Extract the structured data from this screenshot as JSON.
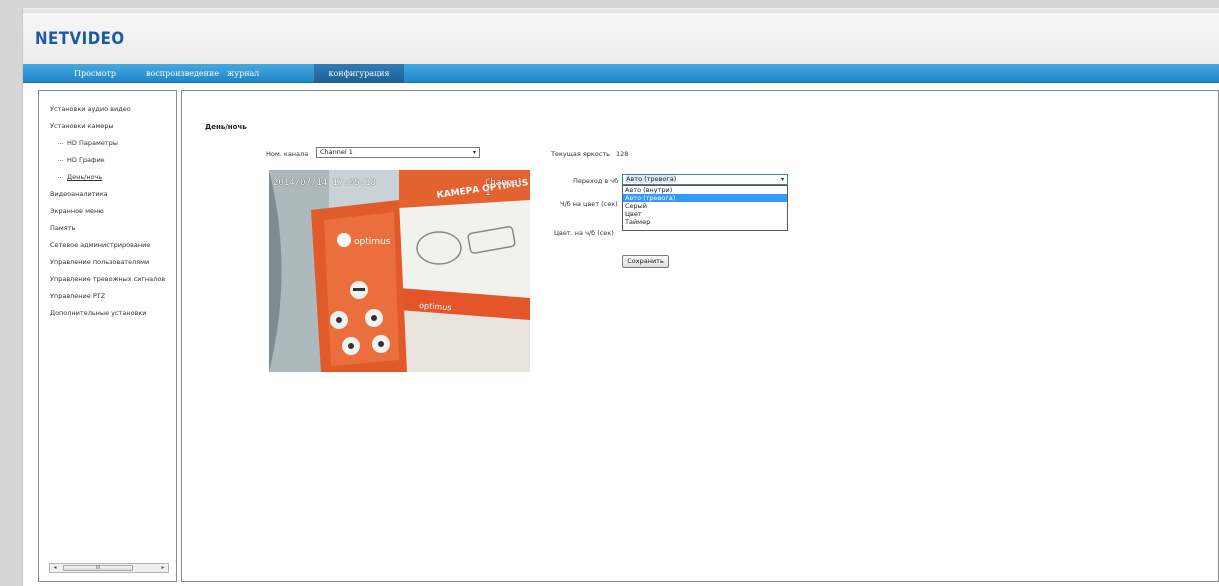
{
  "app": {
    "logo": "NETVIDEO"
  },
  "nav": {
    "items": [
      {
        "label": "Просмотр"
      },
      {
        "label": "воспроизведение"
      },
      {
        "label": "журнал"
      },
      {
        "label": "конфигурация",
        "active": true
      }
    ]
  },
  "sidebar": {
    "items": [
      {
        "label": "Установки аудио видео"
      },
      {
        "label": "Установки камеры"
      },
      {
        "label": "HD Параметры",
        "child": true
      },
      {
        "label": "HD График",
        "child": true
      },
      {
        "label": "День/ночь",
        "child": true,
        "selected": true
      },
      {
        "label": "Видеоаналитика"
      },
      {
        "label": "Экранное меню"
      },
      {
        "label": "Память"
      },
      {
        "label": "Сетевое администрирование"
      },
      {
        "label": "Управление пользователями"
      },
      {
        "label": "Управление тревожных сигналов"
      },
      {
        "label": "Управление PTZ"
      },
      {
        "label": "Дополнительные установки"
      }
    ],
    "scrollbar_grip": "III"
  },
  "main": {
    "title": "День/ночь",
    "channel_label": "Ном. канала",
    "channel_value": "Channel 1",
    "brightness_label": "Текущая яркость",
    "brightness_value": "128",
    "transition_label": "Переход в чб",
    "transition_value": "Авто (тревога)",
    "transition_options": [
      "Авто (внутри)",
      "Авто (тревога)",
      "Серый",
      "Цвет",
      "Таймер"
    ],
    "transition_highlighted_index": 1,
    "bw_to_color_label": "Ч/б на цвет (сек)",
    "color_to_bw_label": "Цвет. на ч/б (сек)",
    "save_label": "Сохранить"
  },
  "video": {
    "timestamp": "2014/07/14 17:05:18",
    "channel_overlay": "Channel 1",
    "brand_text": "optimus",
    "banner_text": "КАМЕРА OPTIMUS"
  },
  "colors": {
    "brand_blue": "#1a5aa6",
    "nav_blue": "#2a8fd0",
    "highlight": "#3399ff",
    "poster_orange": "#e4552a"
  }
}
